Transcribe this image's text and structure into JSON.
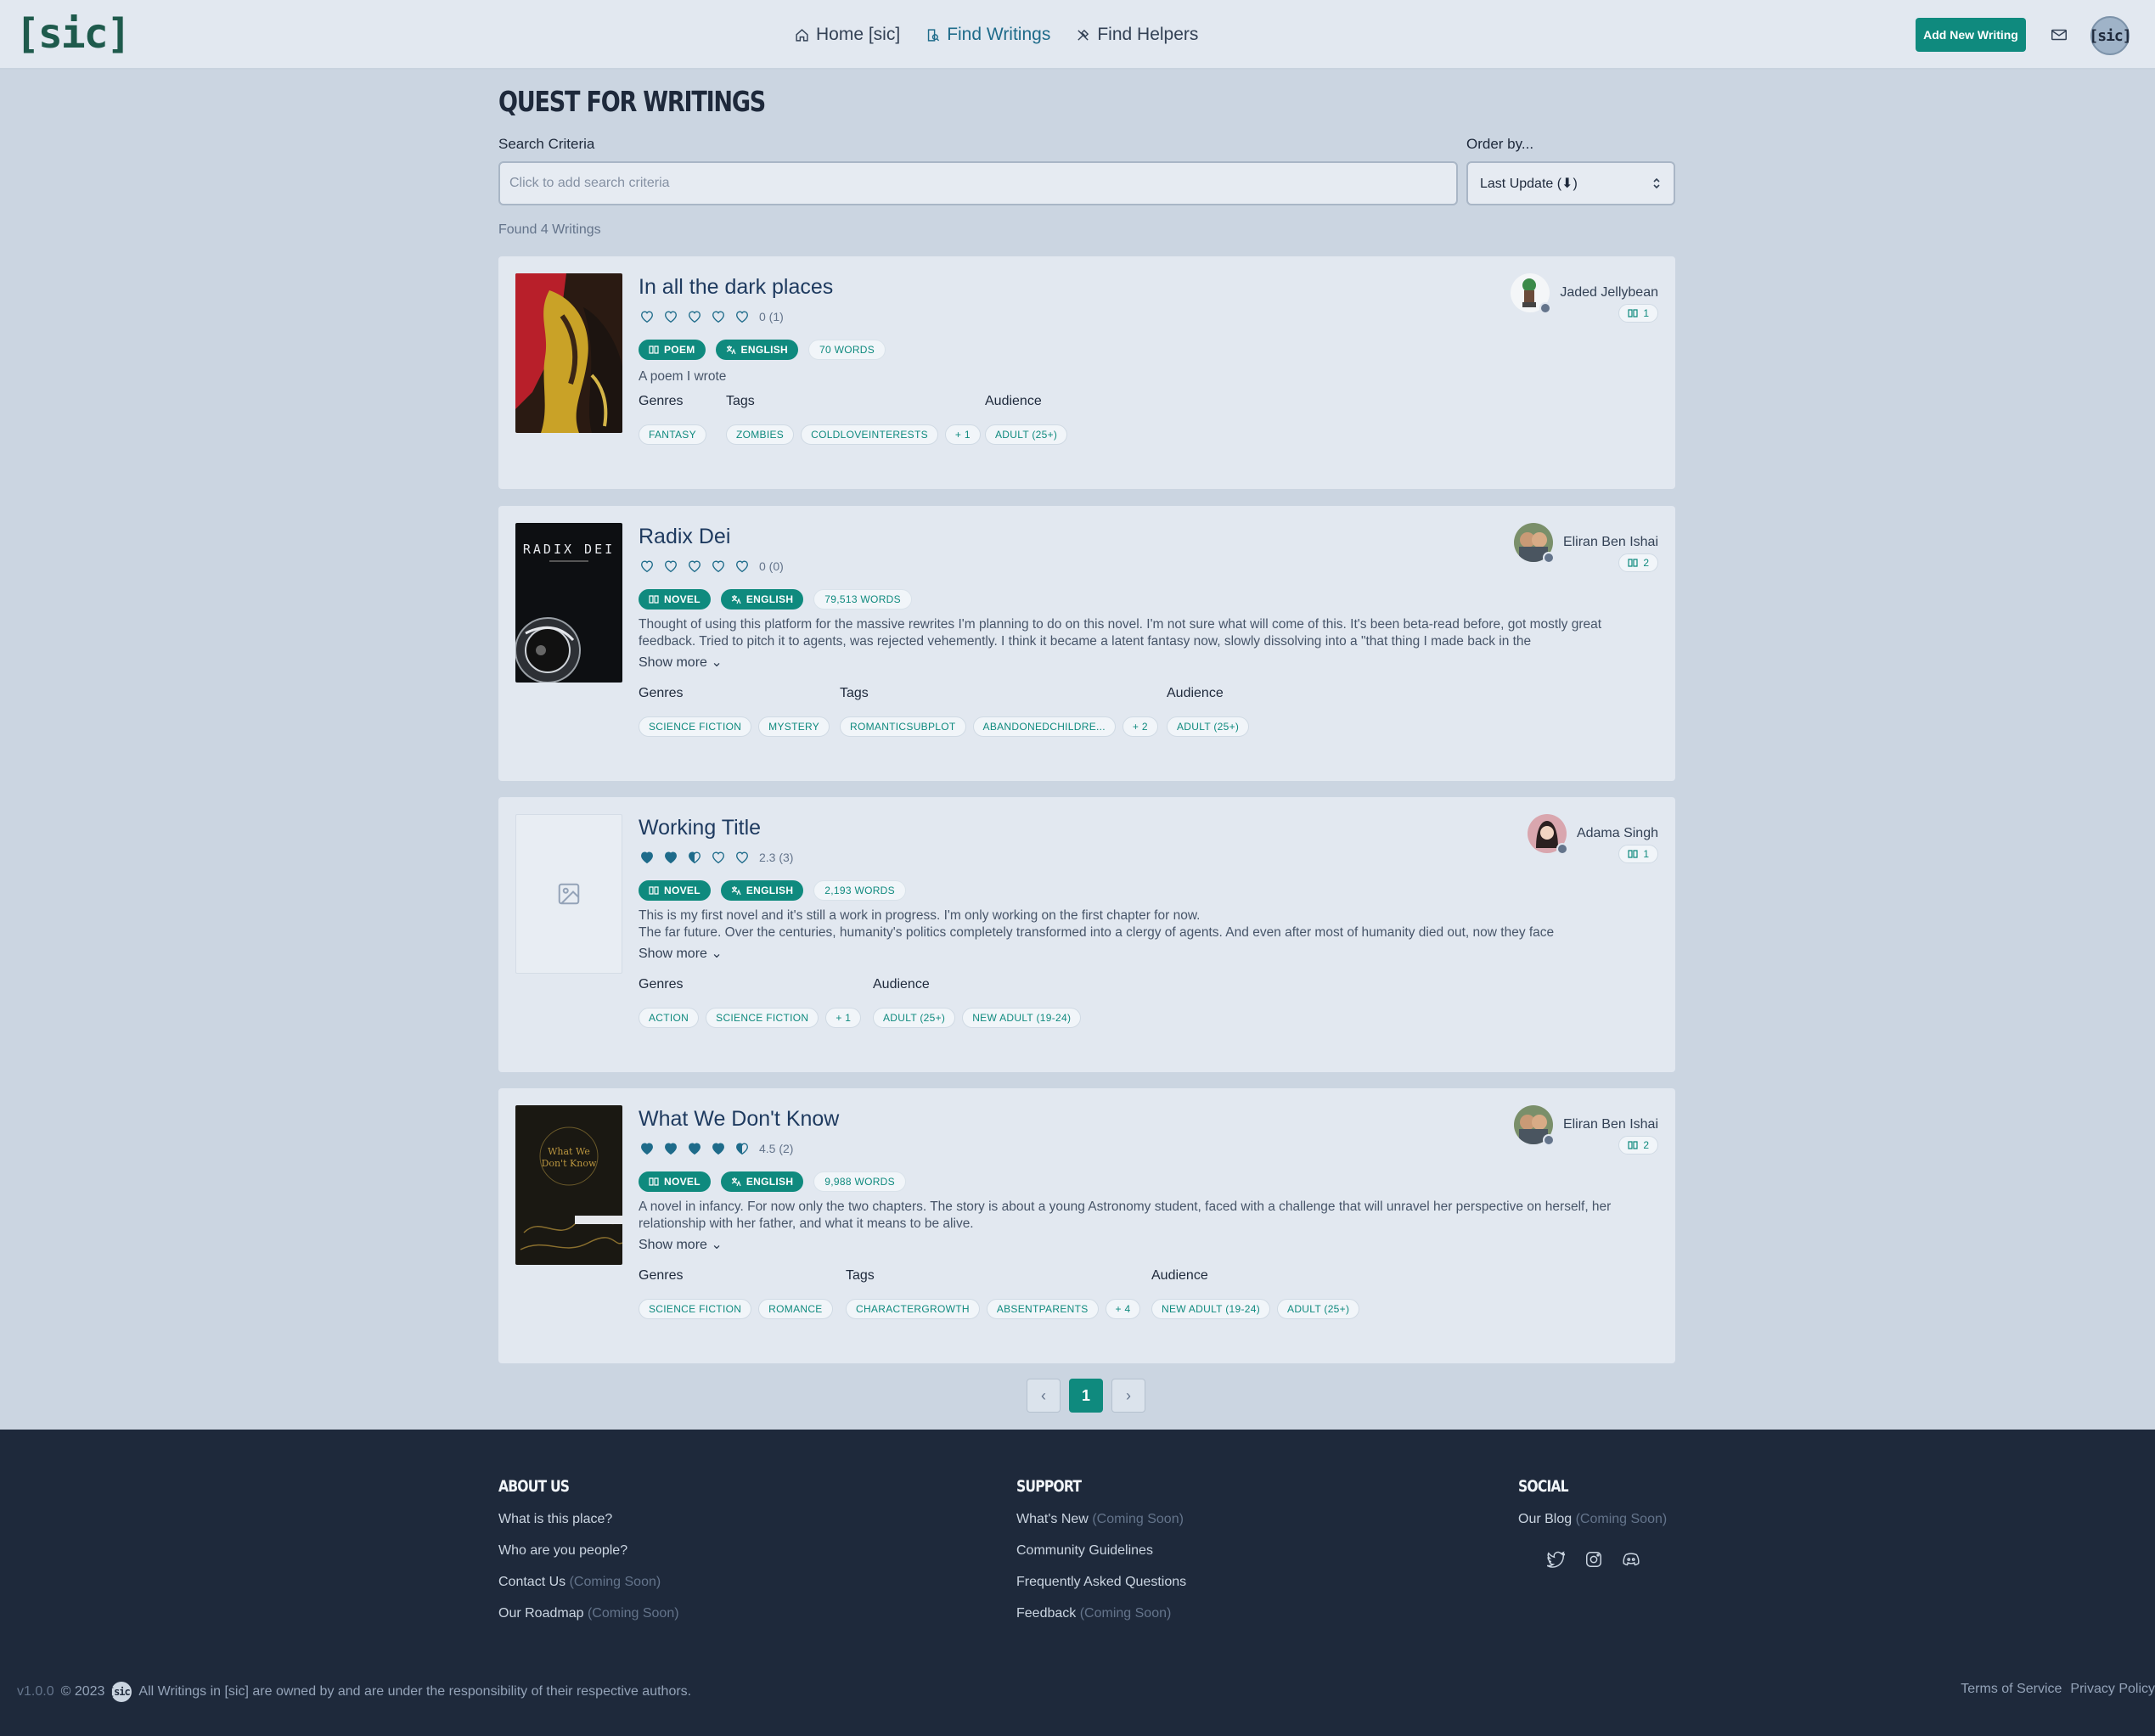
{
  "app": {
    "logo": "[sic]"
  },
  "nav": {
    "home": "Home [sic]",
    "find_writings": "Find Writings",
    "find_helpers": "Find Helpers",
    "add_new": "Add New Writing",
    "avatar_text": "[sic]"
  },
  "page": {
    "title": "QUEST FOR WRITINGS",
    "search_label": "Search Criteria",
    "search_placeholder": "Click to add search criteria",
    "order_label": "Order by...",
    "order_value": "Last Update (⬇)",
    "found": "Found 4 Writings"
  },
  "writings": [
    {
      "title": "In all the dark places",
      "rating_hearts": [
        0,
        0,
        0,
        0,
        0
      ],
      "rating_text": "0 (1)",
      "type": "POEM",
      "language": "ENGLISH",
      "words": "70 WORDS",
      "description": "A poem I wrote",
      "show_more": "",
      "genres": [
        "FANTASY"
      ],
      "tags": [
        "ZOMBIES",
        "COLDLOVEINTERESTS",
        "+ 1"
      ],
      "audience": [
        "ADULT (25+)"
      ],
      "author": "Jaded Jellybean",
      "writings_count": "1"
    },
    {
      "title": "Radix Dei",
      "rating_hearts": [
        0,
        0,
        0,
        0,
        0
      ],
      "rating_text": "0 (0)",
      "type": "NOVEL",
      "language": "ENGLISH",
      "words": "79,513 WORDS",
      "description": "Thought of using this platform for the massive rewrites I'm planning to do on this novel. I'm not sure what will come of this. It's been beta-read before, got mostly great feedback. Tried to pitch it to agents, was rejected vehemently. I think it became a latent fantasy now, slowly dissolving into a \"that thing I made back in the",
      "show_more": "Show more",
      "genres": [
        "SCIENCE FICTION",
        "MYSTERY"
      ],
      "tags": [
        "ROMANTICSUBPLOT",
        "ABANDONEDCHILDRE...",
        "+ 2"
      ],
      "audience": [
        "ADULT (25+)"
      ],
      "author": "Eliran Ben Ishai",
      "writings_count": "2"
    },
    {
      "title": "Working Title",
      "rating_hearts": [
        1,
        1,
        0.5,
        0,
        0
      ],
      "rating_text": "2.3 (3)",
      "type": "NOVEL",
      "language": "ENGLISH",
      "words": "2,193 WORDS",
      "description": "This is my first novel and it's still a work in progress. I'm only working on the first chapter for now.",
      "description2": "The far future. Over the centuries, humanity's politics completely transformed into a clergy of agents. And even after most of humanity died out, now they face",
      "show_more": "Show more",
      "genres": [
        "ACTION",
        "SCIENCE FICTION",
        "+ 1"
      ],
      "tags": [],
      "audience": [
        "ADULT (25+)",
        "NEW ADULT (19-24)"
      ],
      "author": "Adama Singh",
      "writings_count": "1"
    },
    {
      "title": "What We Don't Know",
      "rating_hearts": [
        1,
        1,
        1,
        1,
        0.5
      ],
      "rating_text": "4.5 (2)",
      "type": "NOVEL",
      "language": "ENGLISH",
      "words": "9,988 WORDS",
      "description": "A novel in infancy. For now only the two chapters. The story is about a young Astronomy student, faced with a challenge that will unravel her perspective on herself, her relationship with her father, and what it means to be alive.",
      "show_more": "Show more",
      "genres": [
        "SCIENCE FICTION",
        "ROMANCE"
      ],
      "tags": [
        "CHARACTERGROWTH",
        "ABSENTPARENTS",
        "+ 4"
      ],
      "audience": [
        "NEW ADULT (19-24)",
        "ADULT (25+)"
      ],
      "author": "Eliran Ben Ishai",
      "writings_count": "2"
    }
  ],
  "labels": {
    "genres": "Genres",
    "tags": "Tags",
    "audience": "Audience"
  },
  "pagination": {
    "prev": "‹",
    "current": "1",
    "next": "›"
  },
  "footer": {
    "about_head": "ABOUT US",
    "about": [
      {
        "text": "What is this place?",
        "soon": ""
      },
      {
        "text": "Who are you people?",
        "soon": ""
      },
      {
        "text": "Contact Us",
        "soon": "(Coming Soon)"
      },
      {
        "text": "Our Roadmap",
        "soon": "(Coming Soon)"
      }
    ],
    "support_head": "SUPPORT",
    "support": [
      {
        "text": "What's New",
        "soon": "(Coming Soon)"
      },
      {
        "text": "Community Guidelines",
        "soon": ""
      },
      {
        "text": "Frequently Asked Questions",
        "soon": ""
      },
      {
        "text": "Feedback",
        "soon": "(Coming Soon)"
      }
    ],
    "social_head": "SOCIAL",
    "social": [
      {
        "text": "Our Blog",
        "soon": "(Coming Soon)"
      }
    ],
    "social_icons": [
      "twitter-icon",
      "instagram-icon",
      "discord-icon"
    ],
    "version": "v1.0.0",
    "copyright": "© 2023",
    "mini_logo": "[sic]",
    "notice": "All Writings in [sic] are owned by and are under the responsibility of their respective authors.",
    "terms": "Terms of Service",
    "privacy": "Privacy Policy"
  },
  "colors": {
    "accent": "#0f8a7e",
    "bg": "#cbd5e1",
    "card": "#e2e8f0",
    "footer": "#1e293b"
  }
}
